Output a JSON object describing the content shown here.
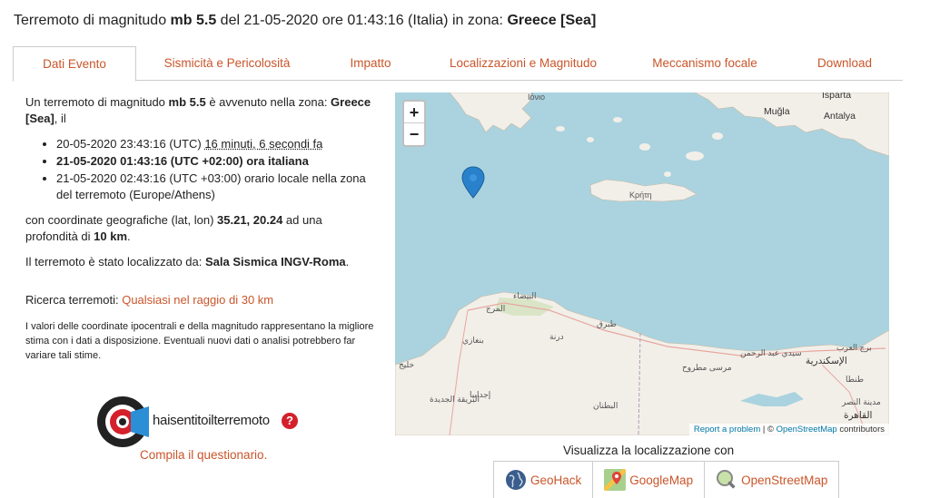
{
  "title": {
    "prefix": "Terremoto di magnitudo ",
    "magnitude": "mb 5.5",
    "mid": " del 21-05-2020 ore 01:43:16 (Italia) in zona: ",
    "zone": "Greece [Sea]"
  },
  "tabs": [
    {
      "label": "Dati Evento"
    },
    {
      "label": "Sismicità e Pericolosità"
    },
    {
      "label": "Impatto"
    },
    {
      "label": "Localizzazioni e Magnitudo"
    },
    {
      "label": "Meccanismo focale"
    },
    {
      "label": "Download"
    }
  ],
  "event": {
    "intro_a": "Un terremoto di magnitudo ",
    "intro_mag": "mb 5.5",
    "intro_b": " è avvenuto nella zona: ",
    "intro_zone": "Greece [Sea]",
    "intro_c": ", il",
    "utc_time": "20-05-2020 23:43:16 (UTC) ",
    "ago": "16 minuti, 6 secondi fa",
    "italy_time": "21-05-2020 01:43:16 (UTC +02:00) ora italiana",
    "local_time": "21-05-2020 02:43:16 (UTC +03:00) orario locale nella zona del terremoto (Europe/Athens)",
    "coords_a": "con coordinate geografiche (lat, lon) ",
    "coords_val": "35.21, 20.24",
    "coords_b": " ad una profondità di ",
    "depth": "10 km",
    "coords_c": ".",
    "located_a": "Il terremoto è stato localizzato da: ",
    "located_by": "Sala Sismica INGV-Roma",
    "located_c": ".",
    "search_label": "Ricerca terremoti: ",
    "search_link": "Qualsiasi nel raggio di 30 km",
    "note": "I valori delle coordinate ipocentrali e della magnitudo rappresentano la migliore stima con i dati a disposizione. Eventuali nuovi dati o analisi potrebbero far variare tali stime."
  },
  "hst": {
    "text_a": "hai",
    "text_b": "sentito",
    "text_c": "il",
    "text_d": "terremoto",
    "q": "?",
    "cta": "Compila il questionario."
  },
  "map": {
    "zoom_in": "+",
    "zoom_out": "−",
    "attrib_report": "Report a problem",
    "attrib_sep": " | © ",
    "attrib_osm": "OpenStreetMap",
    "attrib_tail": " contributors",
    "labels": {
      "ionio": "Ιόνιο",
      "isparta": "Isparta",
      "mugla": "Muğla",
      "antalya": "Antalya",
      "kriti": "Κρήτη",
      "bayda": "البيضاء",
      "marj": "المرج",
      "derna": "درنة",
      "tobruk": "طبرق",
      "benghazi": "بنغازي",
      "ajdabiya": "إجدابيا",
      "burayqa": "البريقة الجديدة",
      "khalij": "خليج",
      "butnan": "البطنان",
      "alex": "الإسكندرية",
      "matruh": "مرسى مطروح",
      "sidi": "سيدي عبد الرحمن",
      "borg": "برج العرب",
      "tanta": "طنطا",
      "cairo": "القاهرة",
      "nasr": "مدينة النصر"
    }
  },
  "viz": {
    "title": "Visualizza la localizzazione con",
    "buttons": [
      {
        "label": "GeoHack",
        "icon": "globe-icon"
      },
      {
        "label": "GoogleMap",
        "icon": "google-maps-icon"
      },
      {
        "label": "OpenStreetMap",
        "icon": "osm-magnifier-icon"
      }
    ]
  },
  "colors": {
    "accent": "#c9552a",
    "sea": "#aad3df",
    "land": "#f2efe9"
  }
}
